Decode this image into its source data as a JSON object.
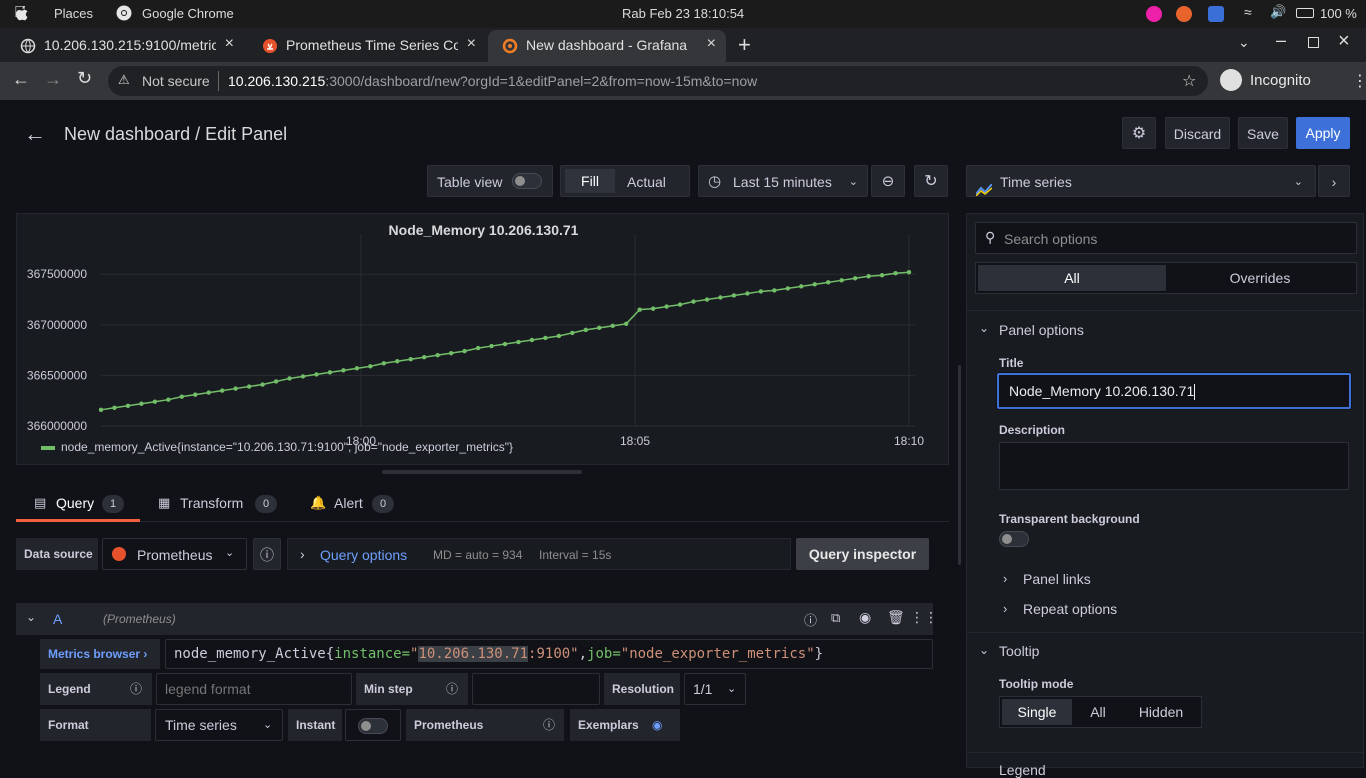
{
  "os": {
    "places": "Places",
    "app": "Google Chrome",
    "clock": "Rab Feb 23  18:10:54",
    "battery": "100 %"
  },
  "tabs": [
    {
      "title": "10.206.130.215:9100/metrics"
    },
    {
      "title": "Prometheus Time Series Collection"
    },
    {
      "title": "New dashboard - Grafana"
    }
  ],
  "address": {
    "security": "Not secure",
    "host": "10.206.130.215",
    "path": ":3000/dashboard/new?orgId=1&editPanel=2&from=now-15m&to=now",
    "profile": "Incognito"
  },
  "header": {
    "title": "New dashboard / Edit Panel",
    "discard": "Discard",
    "save": "Save",
    "apply": "Apply"
  },
  "toolbar": {
    "table_view": "Table view",
    "fill": "Fill",
    "actual": "Actual",
    "time_range": "Last 15 minutes",
    "viz": "Time series"
  },
  "chart_data": {
    "type": "line",
    "title": "Node_Memory 10.206.130.71",
    "x_ticks": [
      "18:00",
      "18:05",
      "18:10"
    ],
    "y_ticks": [
      366000000,
      366500000,
      367000000,
      367500000
    ],
    "ylim": [
      366000000,
      367700000
    ],
    "series": [
      {
        "name": "node_memory_Active{instance=\"10.206.130.71:9100\", job=\"node_exporter_metrics\"}",
        "color": "#73bf69",
        "values": [
          366160000,
          366180000,
          366200000,
          366220000,
          366240000,
          366260000,
          366290000,
          366310000,
          366330000,
          366350000,
          366370000,
          366390000,
          366410000,
          366440000,
          366470000,
          366490000,
          366510000,
          366530000,
          366550000,
          366570000,
          366590000,
          366620000,
          366640000,
          366660000,
          366680000,
          366700000,
          366720000,
          366740000,
          366770000,
          366790000,
          366810000,
          366830000,
          366850000,
          366870000,
          366890000,
          366920000,
          366950000,
          366970000,
          366990000,
          367010000,
          367150000,
          367160000,
          367180000,
          367200000,
          367230000,
          367250000,
          367270000,
          367290000,
          367310000,
          367330000,
          367340000,
          367360000,
          367380000,
          367400000,
          367420000,
          367440000,
          367460000,
          367480000,
          367490000,
          367510000,
          367520000
        ]
      }
    ]
  },
  "query_tabs": [
    {
      "label": "Query",
      "count": "1"
    },
    {
      "label": "Transform",
      "count": "0"
    },
    {
      "label": "Alert",
      "count": "0"
    }
  ],
  "query": {
    "datasource_label": "Data source",
    "datasource": "Prometheus",
    "options_label": "Query options",
    "md": "MD = auto = 934",
    "interval": "Interval = 15s",
    "inspector": "Query inspector",
    "ref": "A",
    "ref_source": "(Prometheus)",
    "metrics_browser": "Metrics browser",
    "expr_metric": "node_memory_Active{",
    "expr_k1": "instance=",
    "expr_q1": "\"",
    "expr_ip": "10.206.130.71",
    "expr_port": ":9100\"",
    "expr_comma": ",",
    "expr_k2": "job=",
    "expr_v2": "\"node_exporter_metrics\"",
    "expr_end": "}",
    "legend_label": "Legend",
    "legend_placeholder": "legend format",
    "minstep_label": "Min step",
    "resolution_label": "Resolution",
    "resolution": "1/1",
    "format_label": "Format",
    "format": "Time series",
    "instant_label": "Instant",
    "type_label": "Prometheus",
    "exemplars_label": "Exemplars"
  },
  "options": {
    "search_placeholder": "Search options",
    "all": "All",
    "overrides": "Overrides",
    "panel_options": "Panel options",
    "title_label": "Title",
    "title_value": "Node_Memory 10.206.130.71",
    "description_label": "Description",
    "transparent_label": "Transparent background",
    "panel_links": "Panel links",
    "repeat_options": "Repeat options",
    "tooltip": "Tooltip",
    "tooltip_mode_label": "Tooltip mode",
    "modes": [
      "Single",
      "All",
      "Hidden"
    ],
    "next_section": "Legend"
  }
}
